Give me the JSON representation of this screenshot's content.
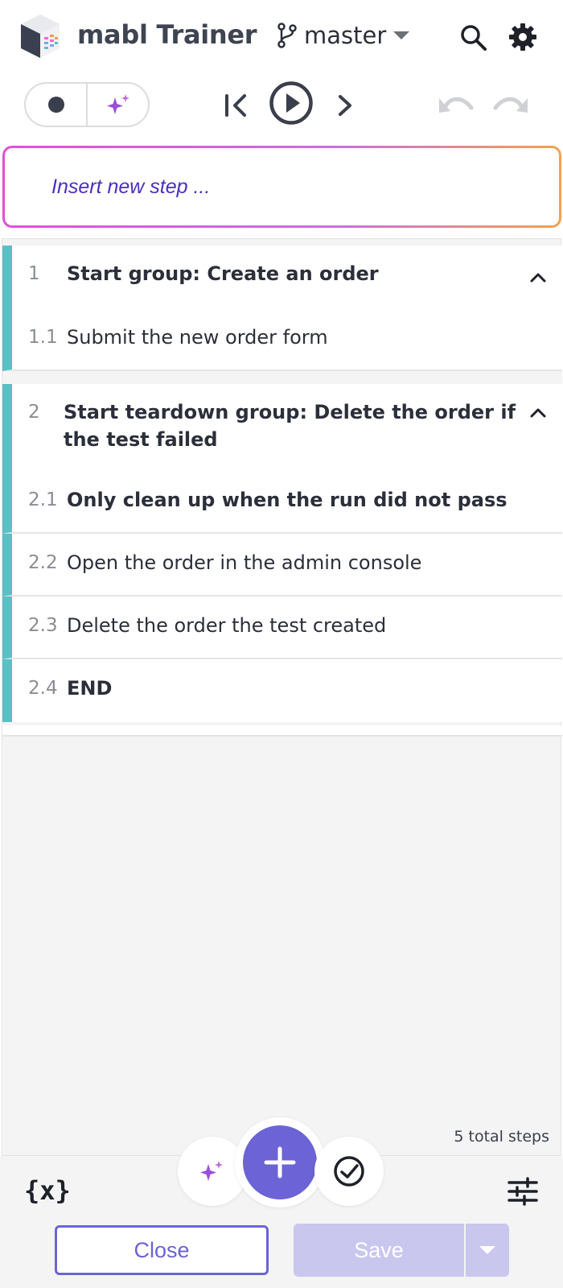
{
  "app": {
    "title": "mabl Trainer",
    "logo_icon": "mabl-cube-logo"
  },
  "branch": {
    "label": "master",
    "icon": "git-branch-icon"
  },
  "toolbar": {
    "record_icon": "record-dot-icon",
    "ai_icon": "sparkle-icon",
    "skip_to_start_icon": "skip-to-start-icon",
    "play_icon": "play-circle-icon",
    "step_forward_icon": "chevron-right-icon",
    "undo_icon": "undo-icon",
    "redo_icon": "redo-icon"
  },
  "insert": {
    "placeholder": "Insert new step ..."
  },
  "steps": [
    {
      "num": "1",
      "text": "Start group: Create an order",
      "bold": true,
      "group": true
    },
    {
      "num": "1.1",
      "text": "Submit the new order form",
      "bold": false
    },
    {
      "num": "2",
      "text": "Start teardown group: Delete the order if the test failed",
      "bold": true,
      "group": true
    },
    {
      "num": "2.1",
      "text": "Only clean up when the run did not pass",
      "bold": true
    },
    {
      "num": "2.2",
      "text": "Open the order in the admin console",
      "bold": false
    },
    {
      "num": "2.3",
      "text": "Delete the order the test created",
      "bold": false
    },
    {
      "num": "2.4",
      "text": "END",
      "bold": true
    }
  ],
  "total_steps": "5 total steps",
  "bottom": {
    "variables_label": "{x}",
    "close_label": "Close",
    "save_label": "Save"
  },
  "colors": {
    "accent": "#6c63d6",
    "step_bar": "#5bc0c5",
    "insert_text": "#4b2fc0",
    "save_disabled": "#c9c7ee"
  }
}
